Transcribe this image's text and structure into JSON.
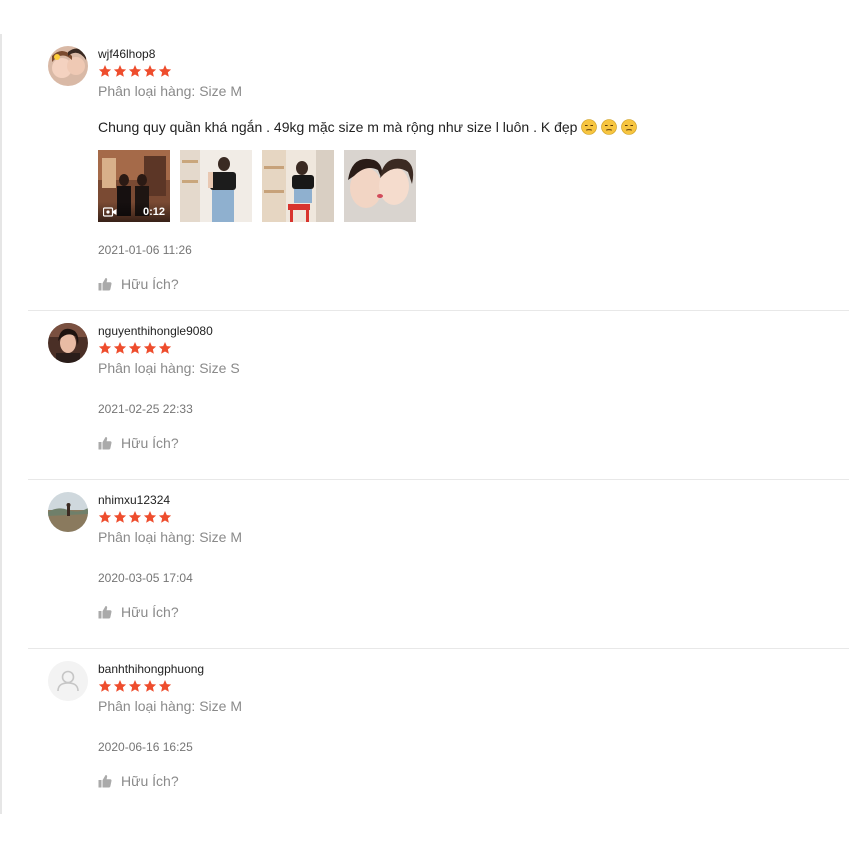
{
  "reviews": [
    {
      "username": "wjf46lhop8",
      "rating": 5,
      "variation": "Phân loại hàng: Size M",
      "comment": "Chung quy quần khá ngắn . 49kg mặc size m mà rộng như size l luôn . K đẹp",
      "comment_emojis": [
        "unamused-face-icon",
        "unamused-face-icon",
        "unamused-face-icon"
      ],
      "media": [
        {
          "type": "video",
          "duration": "0:12"
        },
        {
          "type": "image"
        },
        {
          "type": "image"
        },
        {
          "type": "image"
        }
      ],
      "timestamp": "2021-01-06 11:26",
      "helpful_label": "Hữu Ích?"
    },
    {
      "username": "nguyenthihongle9080",
      "rating": 5,
      "variation": "Phân loại hàng: Size S",
      "timestamp": "2021-02-25 22:33",
      "helpful_label": "Hữu Ích?"
    },
    {
      "username": "nhimxu12324",
      "rating": 5,
      "variation": "Phân loại hàng: Size M",
      "timestamp": "2020-03-05 17:04",
      "helpful_label": "Hữu Ích?"
    },
    {
      "username": "banhthihongphuong",
      "rating": 5,
      "variation": "Phân loại hàng: Size M",
      "timestamp": "2020-06-16 16:25",
      "helpful_label": "Hữu Ích?"
    }
  ],
  "colors": {
    "star": "#ee4d2d",
    "muted_text": "#8a8a8a",
    "divider": "#e8e8e8"
  }
}
